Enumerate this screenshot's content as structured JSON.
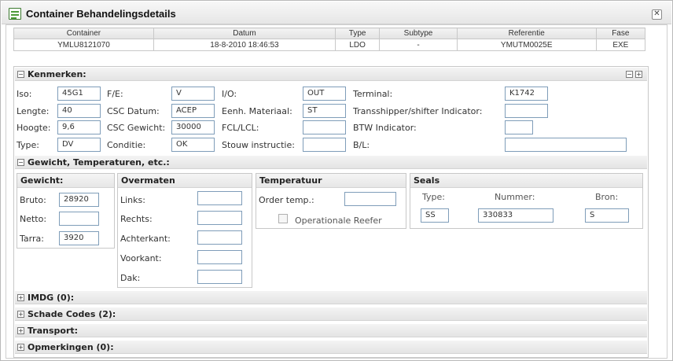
{
  "window": {
    "title": "Container Behandelingsdetails",
    "close_glyph": "✕"
  },
  "summary": {
    "headers": [
      "Container",
      "Datum",
      "Type",
      "Subtype",
      "Referentie",
      "Fase"
    ],
    "row": [
      "YMLU8121070",
      "18-8-2010 18:46:53",
      "LDO",
      "-",
      "YMUTM0025E",
      "EXE"
    ]
  },
  "kenmerken": {
    "title": "Kenmerken:",
    "iso": {
      "label": "Iso:",
      "value": "45G1"
    },
    "lengte": {
      "label": "Lengte:",
      "value": "40"
    },
    "hoogte": {
      "label": "Hoogte:",
      "value": "9,6"
    },
    "type": {
      "label": "Type:",
      "value": "DV"
    },
    "fe": {
      "label": "F/E:",
      "value": "V"
    },
    "csc_datum": {
      "label": "CSC Datum:",
      "value": "ACEP"
    },
    "csc_gewicht": {
      "label": "CSC Gewicht:",
      "value": "30000"
    },
    "conditie": {
      "label": "Conditie:",
      "value": "OK"
    },
    "io": {
      "label": "I/O:",
      "value": "OUT"
    },
    "eenh_materiaal": {
      "label": "Eenh. Materiaal:",
      "value": "ST"
    },
    "fcl_lcl": {
      "label": "FCL/LCL:",
      "value": ""
    },
    "stouw": {
      "label": "Stouw instructie:",
      "value": ""
    },
    "terminal": {
      "label": "Terminal:",
      "value": "K1742"
    },
    "transshipper": {
      "label": "Transshipper/shifter Indicator:",
      "value": ""
    },
    "btw": {
      "label": "BTW Indicator:",
      "value": ""
    },
    "bl": {
      "label": "B/L:",
      "value": ""
    }
  },
  "gewicht_section": {
    "title": "Gewicht, Temperaturen, etc.:"
  },
  "gewicht": {
    "title": "Gewicht:",
    "bruto": {
      "label": "Bruto:",
      "value": "28920"
    },
    "netto": {
      "label": "Netto:",
      "value": ""
    },
    "tarra": {
      "label": "Tarra:",
      "value": "3920"
    }
  },
  "overmaten": {
    "title": "Overmaten",
    "links": {
      "label": "Links:",
      "value": ""
    },
    "rechts": {
      "label": "Rechts:",
      "value": ""
    },
    "achterkant": {
      "label": "Achterkant:",
      "value": ""
    },
    "voorkant": {
      "label": "Voorkant:",
      "value": ""
    },
    "dak": {
      "label": "Dak:",
      "value": ""
    }
  },
  "temperatuur": {
    "title": "Temperatuur",
    "order_temp": {
      "label": "Order temp.:",
      "value": ""
    },
    "reefer": {
      "label": "Operationale Reefer",
      "checked": false
    }
  },
  "seals": {
    "title": "Seals",
    "col_type": "Type:",
    "col_nummer": "Nummer:",
    "col_bron": "Bron:",
    "type_value": "SS",
    "nummer_value": "330833",
    "bron_value": "S"
  },
  "collapsed": {
    "imdg": "IMDG (0):",
    "schade": "Schade Codes (2):",
    "transport": "Transport:",
    "opmerkingen": "Opmerkingen (0):"
  },
  "icons": {
    "expand": "+",
    "collapse": "−"
  }
}
